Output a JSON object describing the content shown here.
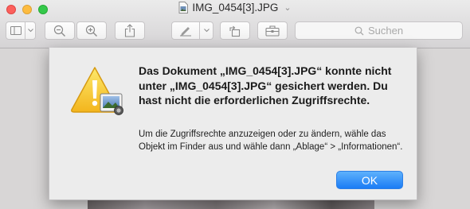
{
  "window": {
    "title": "IMG_0454[3].JPG",
    "title_menu_icon": "chevron-down-icon"
  },
  "toolbar": {
    "search_placeholder": "Suchen",
    "icons": [
      "sidebar-icon",
      "zoom-out-icon",
      "zoom-in-icon",
      "share-icon",
      "markup-pen-icon",
      "rotate-icon",
      "toolbox-icon",
      "search-icon"
    ]
  },
  "dialog": {
    "headline": "Das Dokument „IMG_0454[3].JPG“ konnte nicht unter „IMG_0454[3].JPG“ gesichert werden. Du hast nicht die erforderlichen Zugriffsrechte.",
    "info": "Um die Zugriffsrechte anzuzeigen oder zu ändern, wähle das Objekt im Finder aus und wähle dann „Ablage“ > „Informationen“.",
    "ok_label": "OK",
    "icon": "caution-warning-icon",
    "accent_color": "#1b7cf5"
  }
}
